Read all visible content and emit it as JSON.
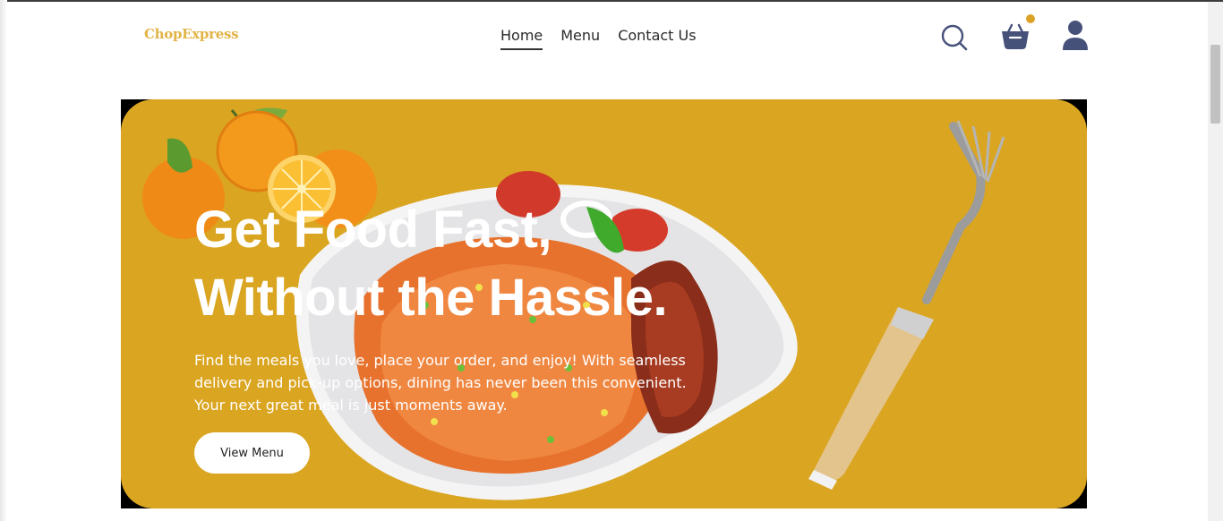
{
  "brand": {
    "logo_text": "ChopExpress",
    "accent_color": "#daa521",
    "logo_color": "#e2b447"
  },
  "nav": {
    "items": [
      {
        "label": "Home",
        "active": true
      },
      {
        "label": "Menu",
        "active": false
      },
      {
        "label": "Contact Us",
        "active": false
      }
    ]
  },
  "header_icons": {
    "search": "search-icon",
    "cart": "basket-icon",
    "cart_badge_color": "#dca227",
    "user": "user-icon",
    "icon_color": "#46517a"
  },
  "hero": {
    "title_line1": "Get Food Fast,",
    "title_line2": "Without the Hassle.",
    "description": "Find the meals you love, place your order, and enjoy! With seamless delivery and pick-up options, dining has never been this convenient. Your next great meal is just moments away.",
    "cta_label": "View Menu",
    "images": [
      "oranges-image",
      "jollof-rice-plate-image",
      "fork-image"
    ]
  }
}
